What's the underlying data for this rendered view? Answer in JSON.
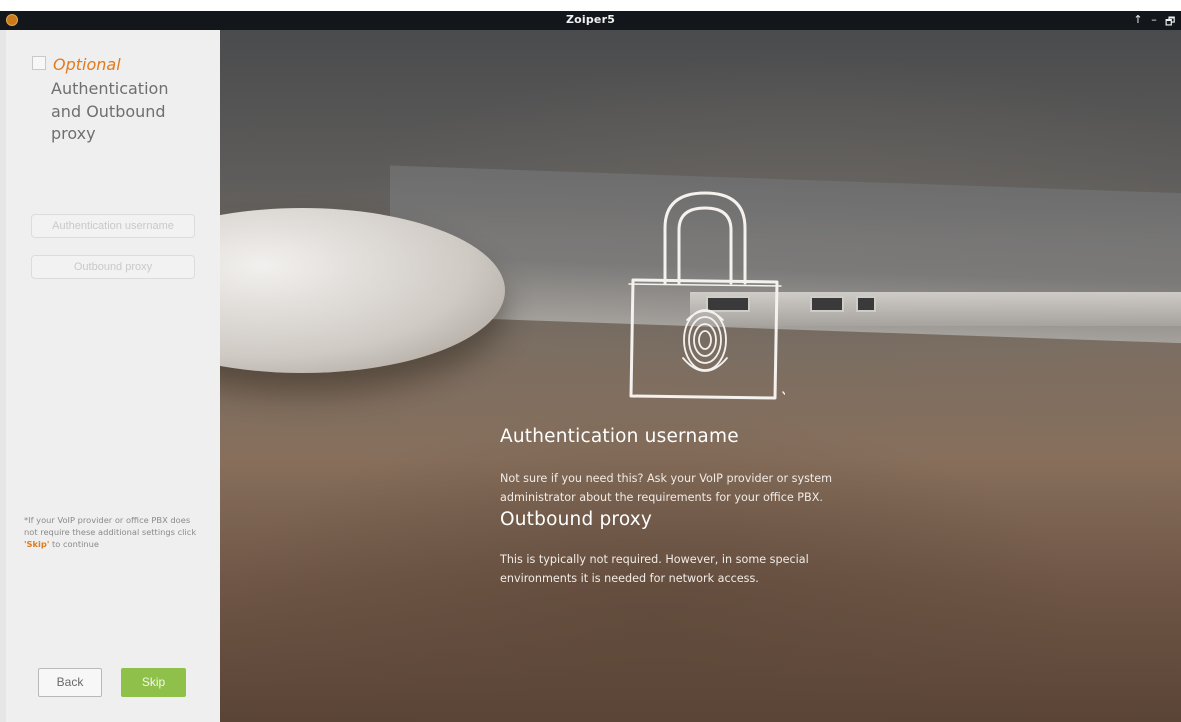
{
  "window": {
    "title": "Zoiper5",
    "controls": {
      "up": "↑",
      "minimize": "–",
      "restore": "🗗"
    }
  },
  "sidebar": {
    "optional_label": "Optional",
    "step_title": "Authentication and Outbound proxy",
    "auth_username_placeholder": "Authentication username",
    "outbound_proxy_placeholder": "Outbound proxy",
    "hint_prefix": "*If your VoIP provider or office PBX does not require these additional settings click ",
    "hint_skip": "'Skip'",
    "hint_suffix": " to continue",
    "back_label": "Back",
    "skip_label": "Skip"
  },
  "main": {
    "auth_heading": "Authentication username",
    "auth_text": "Not sure if you need this? Ask your VoIP provider or system administrator about the requirements for your office PBX.",
    "proxy_heading": "Outbound proxy",
    "proxy_text": "This is typically not required. However, in some special environments it is needed for network access."
  },
  "colors": {
    "accent_orange": "#e07b1f",
    "skip_green": "#8fc049",
    "titlebar": "#13171c",
    "sidebar_bg": "#efefef"
  }
}
